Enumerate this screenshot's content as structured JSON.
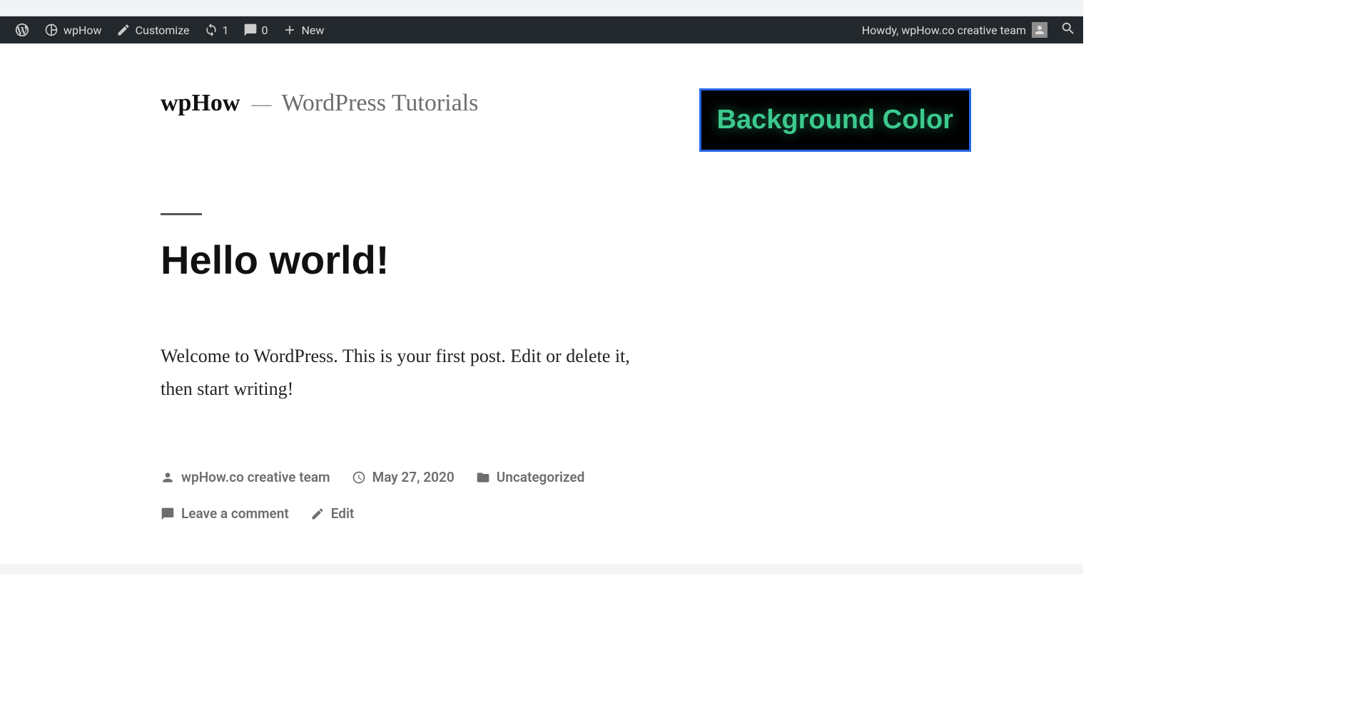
{
  "adminbar": {
    "site_name": "wpHow",
    "customize": "Customize",
    "updates_count": "1",
    "comments_count": "0",
    "new_label": "New",
    "howdy": "Howdy, wpHow.co creative team"
  },
  "header": {
    "title": "wpHow",
    "separator": "—",
    "description": "WordPress Tutorials"
  },
  "callout": {
    "text": "Background Color"
  },
  "post": {
    "title": "Hello world!",
    "body": "Welcome to WordPress. This is your first post. Edit or delete it, then start writing!",
    "meta": {
      "author": "wpHow.co creative team",
      "date": "May 27, 2020",
      "category": "Uncategorized",
      "comments": "Leave a comment",
      "edit": "Edit"
    }
  }
}
